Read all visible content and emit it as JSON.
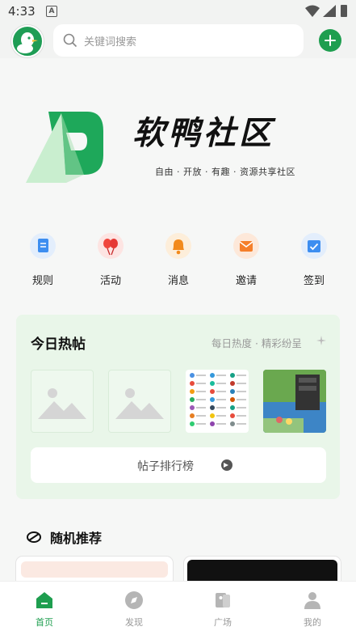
{
  "status_bar": {
    "time": "4:33"
  },
  "search": {
    "placeholder": "关键词搜索"
  },
  "banner": {
    "title": "软鸭社区",
    "subtitle": "自由 · 开放 · 有趣 · 资源共享社区"
  },
  "menu": [
    {
      "label": "规则",
      "icon": "document-icon",
      "color": "#3d8ef0"
    },
    {
      "label": "活动",
      "icon": "balloons-icon",
      "color": "#f0463d"
    },
    {
      "label": "消息",
      "icon": "bell-icon",
      "color": "#f28a1c"
    },
    {
      "label": "邀请",
      "icon": "envelope-icon",
      "color": "#f57f2a"
    },
    {
      "label": "签到",
      "icon": "calendar-check-icon",
      "color": "#3d8ef0"
    }
  ],
  "hot_posts": {
    "title": "今日热帖",
    "subtitle": "每日热度 · 精彩纷呈",
    "rank_button": "帖子排行榜"
  },
  "random": {
    "title": "随机推荐"
  },
  "tabs": [
    {
      "label": "首页",
      "active": true
    },
    {
      "label": "发现",
      "active": false
    },
    {
      "label": "广场",
      "active": false
    },
    {
      "label": "我的",
      "active": false
    }
  ],
  "colors": {
    "accent": "#1e9e4f",
    "hot_bg": "#e9f6e9"
  }
}
